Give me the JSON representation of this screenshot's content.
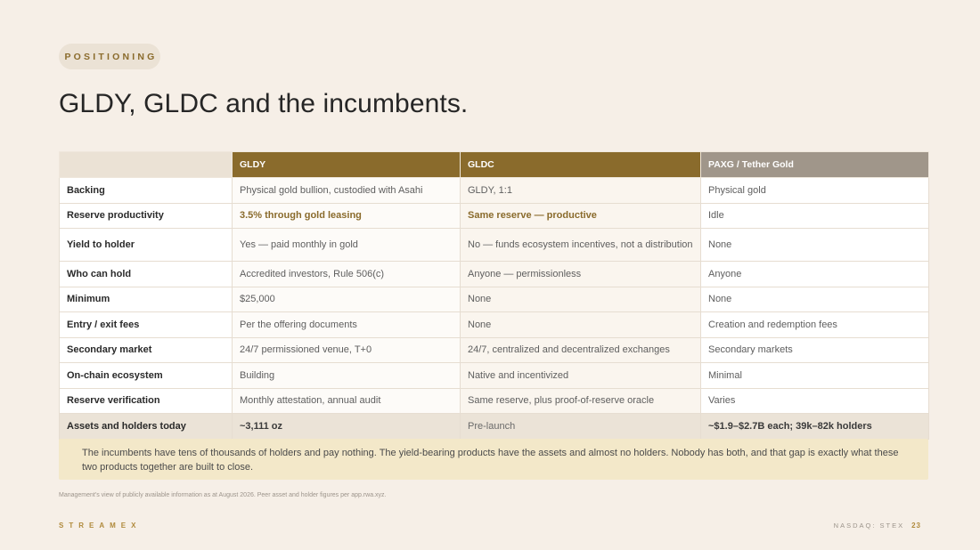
{
  "eyebrow": "POSITIONING",
  "title": "GLDY, GLDC and the incumbents.",
  "table": {
    "headers": [
      "",
      "GLDY",
      "GLDC",
      "PAXG / Tether Gold"
    ],
    "rows": [
      [
        "Backing",
        "Physical gold bullion, custodied with Asahi",
        "GLDY, 1:1",
        "Physical gold"
      ],
      [
        "Reserve productivity",
        "3.5% through gold leasing",
        "Same reserve — productive",
        "Idle"
      ],
      [
        "Yield to holder",
        "Yes — paid monthly in gold",
        "No — funds ecosystem incentives, not a distribution",
        "None"
      ],
      [
        "Who can hold",
        "Accredited investors, Rule 506(c)",
        "Anyone — permissionless",
        "Anyone"
      ],
      [
        "Minimum",
        "$25,000",
        "None",
        "None"
      ],
      [
        "Entry / exit fees",
        "Per the offering documents",
        "None",
        "Creation and redemption fees"
      ],
      [
        "Secondary market",
        "24/7 permissioned venue, T+0",
        "24/7, centralized and decentralized exchanges",
        "Secondary markets"
      ],
      [
        "On-chain ecosystem",
        "Building",
        "Native and incentivized",
        "Minimal"
      ],
      [
        "Reserve verification",
        "Monthly attestation, annual audit",
        "Same reserve, plus proof-of-reserve oracle",
        "Varies"
      ],
      [
        "Assets and holders today",
        "~3,111 oz",
        "Pre-launch",
        "~$1.9–$2.7B each; 39k–82k holders"
      ]
    ]
  },
  "callout": "The incumbents have tens of thousands of holders and pay nothing. The yield-bearing products have the assets and almost no holders. Nobody has both, and that gap is exactly what these two products together are built to close.",
  "footnote": "Management's view of publicly available information as at August 2026. Peer asset and holder figures per app.rwa.xyz.",
  "footer": {
    "brand": "STREAMEX",
    "ticker": "NASDAQ: STEX",
    "page": "23"
  },
  "colors": {
    "accent_gold": "#8a6b2c",
    "peer_grey": "#a0968a",
    "background": "#f6efe7",
    "callout": "#f3e8c9"
  }
}
